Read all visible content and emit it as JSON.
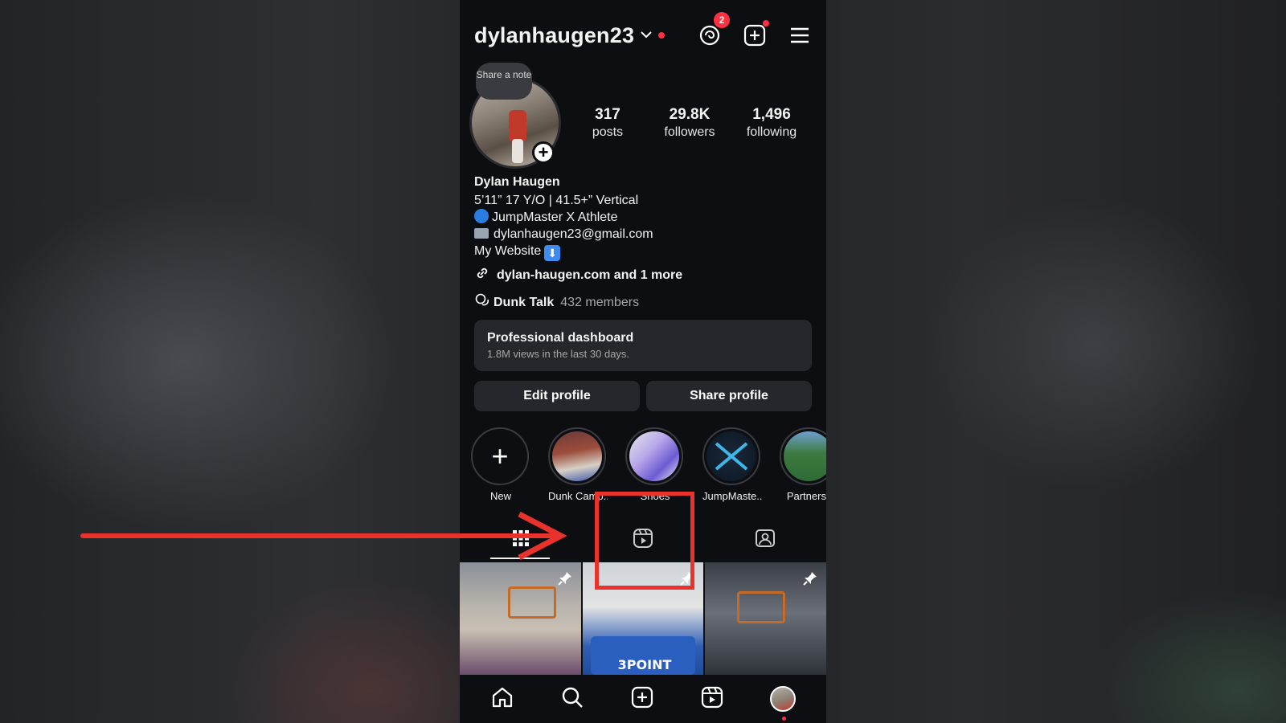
{
  "header": {
    "username": "dylanhaugen23",
    "threads_badge": "2"
  },
  "profile": {
    "note_label": "Share a note",
    "stats": [
      {
        "value": "317",
        "label": "posts"
      },
      {
        "value": "29.8K",
        "label": "followers"
      },
      {
        "value": "1,496",
        "label": "following"
      }
    ],
    "name": "Dylan Haugen",
    "bio_lines": [
      "5’11” 17 Y/O | 41.5+” Vertical",
      "JumpMaster X Athlete",
      "dylanhaugen23@gmail.com",
      "My Website"
    ],
    "link": "dylan-haugen.com and 1 more",
    "community": {
      "name": "Dunk Talk",
      "members": "432 members"
    }
  },
  "dashboard": {
    "title": "Professional dashboard",
    "subtitle": "1.8M views in the last 30 days."
  },
  "buttons": {
    "edit": "Edit profile",
    "share": "Share profile"
  },
  "highlights": [
    {
      "label": "New",
      "icon": "plus-icon"
    },
    {
      "label": "Dunk Camp..."
    },
    {
      "label": "Shoes"
    },
    {
      "label": "JumpMaste..."
    },
    {
      "label": "Partnersh"
    }
  ],
  "tabs": [
    {
      "name": "grid",
      "icon": "grid-icon"
    },
    {
      "name": "reels",
      "icon": "reels-icon"
    },
    {
      "name": "tagged",
      "icon": "tagged-icon"
    }
  ],
  "grid_posts": [
    {
      "pinned": true
    },
    {
      "pinned": true,
      "banner_text": "3POINT"
    },
    {
      "pinned": true
    }
  ],
  "bottom_nav": [
    "home-icon",
    "search-icon",
    "create-icon",
    "reels-icon",
    "profile-avatar"
  ],
  "colors": {
    "accent_red": "#ff3040",
    "annotation_red": "#e8322b",
    "link_blue": "#3f8cf0"
  }
}
